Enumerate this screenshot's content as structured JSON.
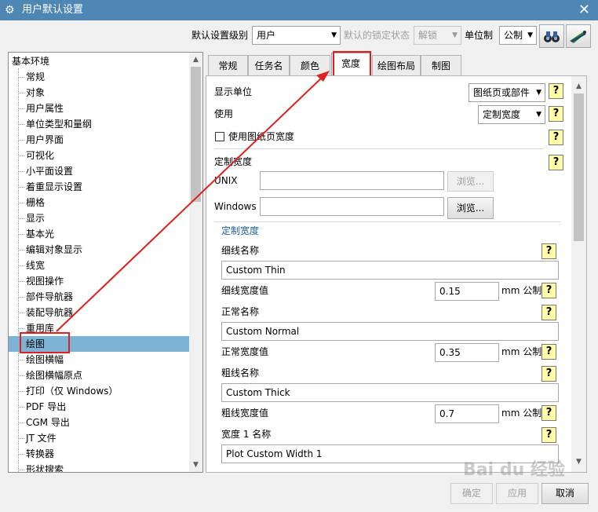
{
  "window": {
    "title": "用户默认设置",
    "close_glyph": "✕",
    "app_glyph": "⚙"
  },
  "toolbar": {
    "level_label": "默认设置级别",
    "level_value": "用户",
    "lock_label": "默认的锁定状态",
    "lock_value": "解锁",
    "unit_label": "单位制",
    "unit_value": "公制",
    "icons": [
      "binoculars-icon",
      "plane-wand-icon"
    ]
  },
  "tree": {
    "root": "基本环境",
    "items": [
      "常规",
      "对象",
      "用户属性",
      "单位类型和量纲",
      "用户界面",
      "可视化",
      "小平面设置",
      "着重显示设置",
      "栅格",
      "显示",
      "基本光",
      "编辑对象显示",
      "线宽",
      "视图操作",
      "部件导航器",
      "装配导航器",
      "重用库",
      "绘图",
      "绘图横幅",
      "绘图横幅原点",
      "打印（仅 Windows）",
      "PDF 导出",
      "CGM 导出",
      "JT 文件",
      "转换器",
      "形状搜索"
    ],
    "selected": "绘图"
  },
  "tabs": [
    "常规",
    "任务名",
    "颜色",
    "宽度",
    "绘图布局",
    "制图"
  ],
  "active_tab": "宽度",
  "panel": {
    "display_units_label": "显示单位",
    "display_units_value": "图纸页或部件",
    "use_label": "使用",
    "use_value": "定制宽度",
    "use_sheet_width_label": "使用图纸页宽度",
    "use_sheet_width_checked": false,
    "custom_width_label": "定制宽度",
    "unix_label": "UNIX",
    "unix_value": "",
    "browse_label": "浏览...",
    "windows_label": "Windows",
    "windows_value": "",
    "group_title": "定制宽度",
    "help_glyph": "?",
    "unit_suffix": "mm 公制",
    "fields": [
      {
        "name_label": "细线名称",
        "name_value": "Custom Thin",
        "width_label": "细线宽度值",
        "width_value": "0.15"
      },
      {
        "name_label": "正常名称",
        "name_value": "Custom Normal",
        "width_label": "正常宽度值",
        "width_value": "0.35"
      },
      {
        "name_label": "粗线名称",
        "name_value": "Custom Thick",
        "width_label": "粗线宽度值",
        "width_value": "0.7"
      },
      {
        "name_label": "宽度 1 名称",
        "name_value": "Plot Custom Width 1"
      }
    ]
  },
  "footer": {
    "ok": "确定",
    "apply": "应用",
    "cancel": "取消"
  },
  "watermark": "Bai du 经验",
  "colors": {
    "title_bar": "#4e87b4",
    "selection": "#7fb3d5",
    "highlight": "#e02020",
    "help_bg": "#fffba6"
  }
}
